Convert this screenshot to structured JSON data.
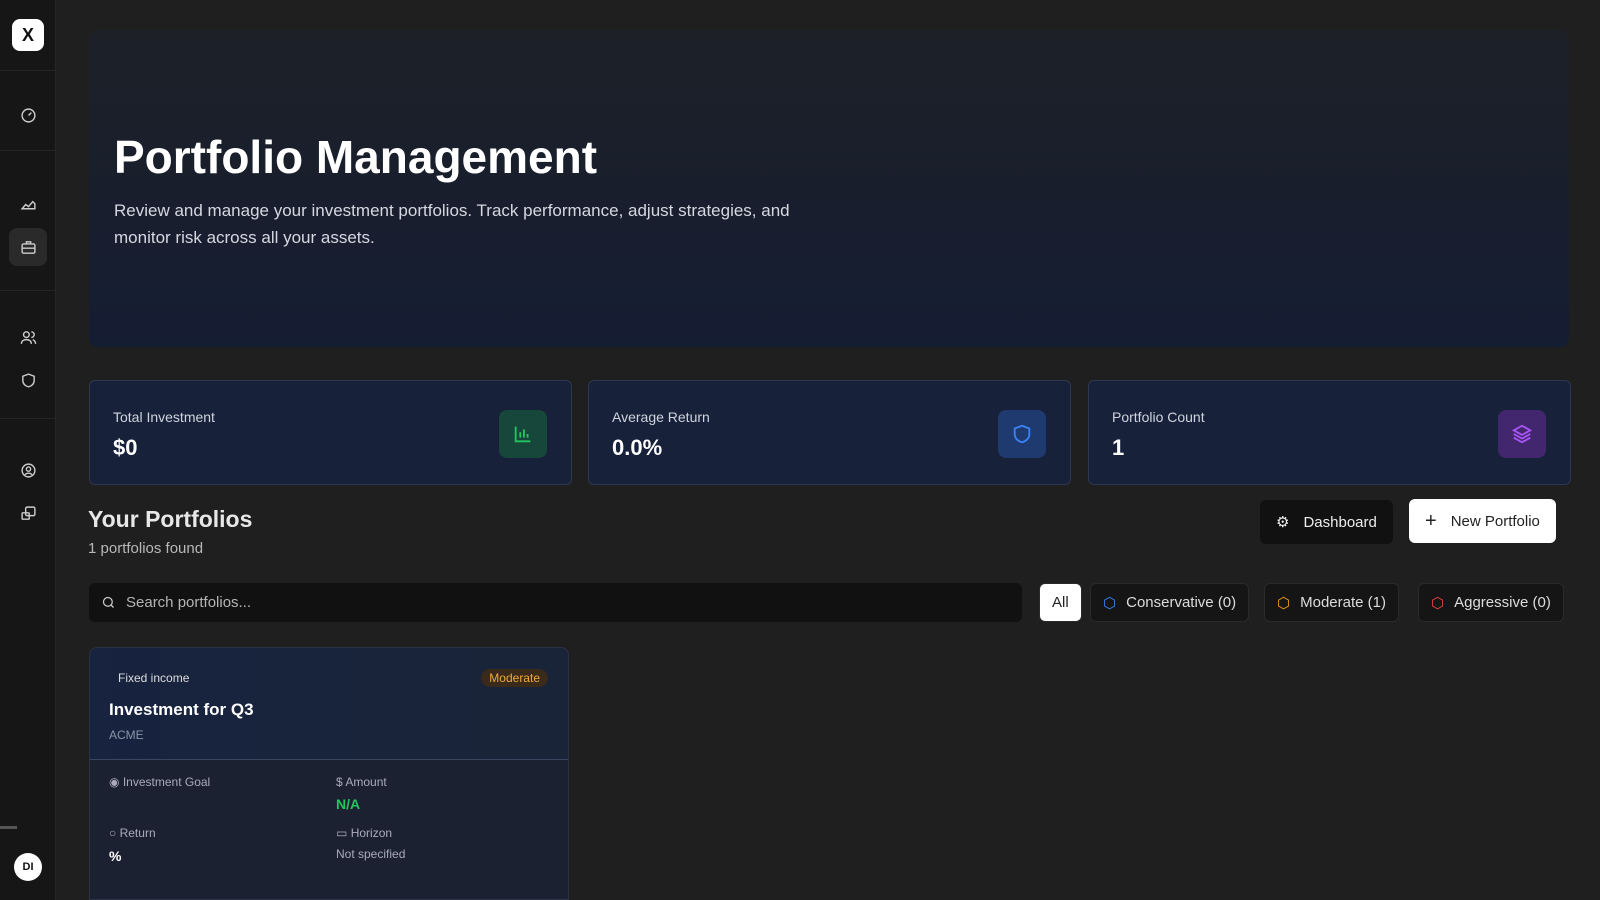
{
  "sidebar": {
    "logo": "X",
    "avatar": "DI",
    "items": [
      "dashboard",
      "analytics",
      "portfolios",
      "clients",
      "security",
      "profile",
      "devices"
    ]
  },
  "hero": {
    "title": "Portfolio Management",
    "description": "Review and manage your investment portfolios. Track performance, adjust strategies, and monitor risk across all your assets."
  },
  "stats": [
    {
      "label": "Total Investment",
      "value": "$0",
      "icon": "bar-chart-icon",
      "color": "#22c55e"
    },
    {
      "label": "Average Return",
      "value": "0.0%",
      "icon": "shield-icon",
      "color": "#3b82f6"
    },
    {
      "label": "Portfolio Count",
      "value": "1",
      "icon": "layers-icon",
      "color": "#a855f7"
    }
  ],
  "portfolios": {
    "title": "Your Portfolios",
    "count_text": "1 portfolios found",
    "dashboard_label": "Dashboard",
    "new_label": "New Portfolio",
    "search_placeholder": "Search portfolios...",
    "filters": [
      {
        "label": "All"
      },
      {
        "label": "Conservative (0)",
        "color": "#3b82f6"
      },
      {
        "label": "Moderate (1)",
        "color": "#f59e0b"
      },
      {
        "label": "Aggressive (0)",
        "color": "#ef4444"
      }
    ]
  },
  "card": {
    "type": "Fixed income",
    "risk": "Moderate",
    "name": "Investment for Q3",
    "client": "ACME",
    "goal_label": "Investment Goal",
    "amount_label": "Amount",
    "amount": "N/A",
    "return_label": "Return",
    "return": "%",
    "horizon_label": "Horizon",
    "horizon": "Not specified"
  }
}
